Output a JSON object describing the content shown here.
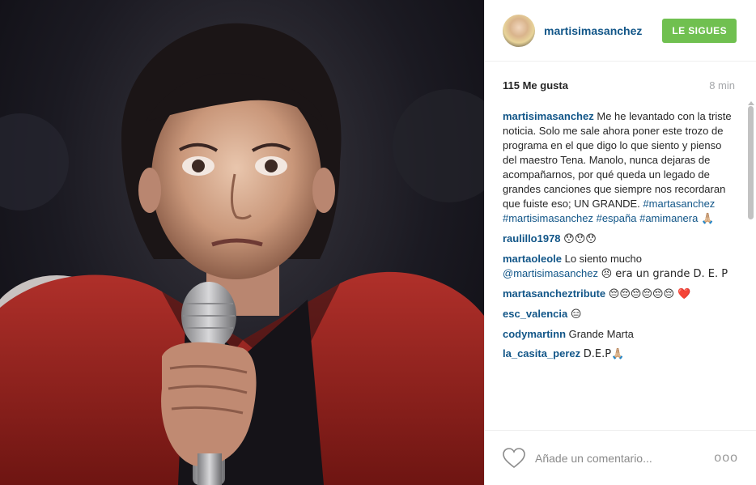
{
  "post": {
    "username": "martisimasanchez",
    "follow_label": "LE SIGUES",
    "likes": "115 Me gusta",
    "time": "8 min"
  },
  "caption": {
    "username": "martisimasanchez",
    "text": "Me he levantado con la triste noticia. Solo me sale ahora poner este trozo de programa en el que digo lo que siento y pienso del maestro Tena. Manolo, nunca dejaras de acompañarnos, por qué queda un legado de grandes canciones que siempre nos recordaran que fuiste eso; UN GRANDE.",
    "hashtags": "#martasanchez #martisimasanchez #españa #amimanera",
    "emoji": "🙏🏼"
  },
  "comments": [
    {
      "user": "raulillo1978",
      "text": "😯😯😯"
    },
    {
      "user": "martaoleole",
      "text": "Lo siento mucho",
      "mention": "@martisimasanchez",
      "text2": "😣 era un grande D. E. P"
    },
    {
      "user": "martasancheztribute",
      "text": "😔😔😔😔😔😔 ❤️"
    },
    {
      "user": "esc_valencia",
      "text": "😑"
    },
    {
      "user": "codymartinn",
      "text": "Grande Marta"
    },
    {
      "user": "la_casita_perez",
      "text": "D.E.P🙏🏼"
    }
  ],
  "footer": {
    "comment_placeholder": "Añade un comentario...",
    "more_label": "ooo"
  },
  "colors": {
    "link": "#125688",
    "follow_bg": "#70c050",
    "muted": "#a5a7aa"
  }
}
